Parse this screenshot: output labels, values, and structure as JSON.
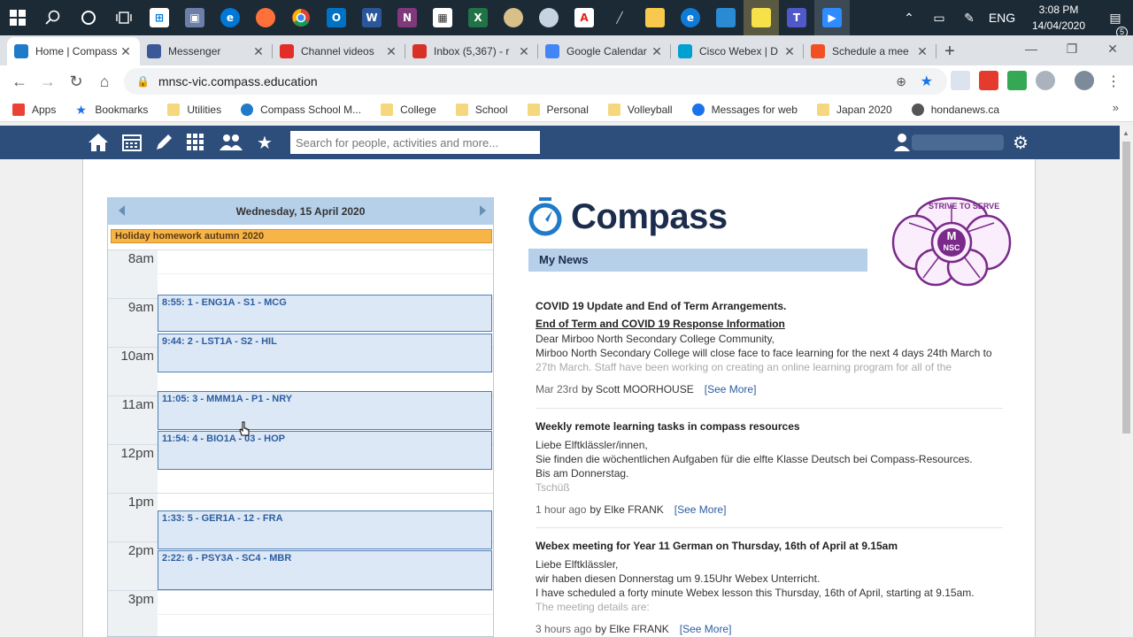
{
  "taskbar": {
    "apps": [
      "Windows",
      "Search",
      "Cortana",
      "Task View",
      "Store",
      "Save",
      "Edge",
      "Firefox",
      "Chrome",
      "Outlook",
      "Word",
      "OneNote",
      "Calculator",
      "Excel",
      "Paint",
      "Network",
      "Acrobat",
      "Pen",
      "Explorer",
      "Edge",
      "Photos",
      "Sticky Notes",
      "Teams",
      "Zoom"
    ],
    "language": "ENG",
    "time": "3:08 PM",
    "date": "14/04/2020",
    "notifications": "5"
  },
  "tabs": [
    {
      "title": "Home | Compass",
      "favicon": "compass-icon",
      "color": "#1f7ac9",
      "active": true
    },
    {
      "title": "Messenger",
      "favicon": "facebook-icon",
      "color": "#3b5998"
    },
    {
      "title": "Channel videos",
      "favicon": "youtube-icon",
      "color": "#e52d27"
    },
    {
      "title": "Inbox (5,367) - r",
      "favicon": "gmail-icon",
      "color": "#d93025"
    },
    {
      "title": "Google Calendar",
      "favicon": "calendar-icon",
      "color": "#4285f4"
    },
    {
      "title": "Cisco Webex | D",
      "favicon": "webex-icon",
      "color": "#00a0d1"
    },
    {
      "title": "Schedule a mee",
      "favicon": "microsoft-icon",
      "color": "#f25022"
    }
  ],
  "address": {
    "url": "mnsc-vic.compass.education"
  },
  "bookmarks": [
    {
      "label": "Apps",
      "icon": "apps-grid-icon"
    },
    {
      "label": "Bookmarks",
      "icon": "star-icon"
    },
    {
      "label": "Utilities",
      "icon": "folder-icon"
    },
    {
      "label": "Compass School M...",
      "icon": "compass-icon"
    },
    {
      "label": "College",
      "icon": "folder-icon"
    },
    {
      "label": "School",
      "icon": "folder-icon"
    },
    {
      "label": "Personal",
      "icon": "folder-icon"
    },
    {
      "label": "Volleyball",
      "icon": "folder-icon"
    },
    {
      "label": "Messages for web",
      "icon": "messages-icon"
    },
    {
      "label": "Japan 2020",
      "icon": "folder-icon"
    },
    {
      "label": "hondanews.ca",
      "icon": "globe-icon"
    }
  ],
  "compass_nav": {
    "search_placeholder": "Search for people, activities and more..."
  },
  "calendar": {
    "date": "Wednesday, 15 April 2020",
    "all_day": "Holiday homework autumn 2020",
    "hours": [
      "8am",
      "9am",
      "10am",
      "11am",
      "12pm",
      "1pm",
      "2pm",
      "3pm"
    ],
    "events": [
      {
        "label": "8:55: 1 - ENG1A - S1 - MCG",
        "start": 8.92,
        "end": 9.7
      },
      {
        "label": "9:44: 2 - LST1A - S2 - HIL",
        "start": 9.73,
        "end": 10.53
      },
      {
        "label": "11:05: 3 - MMM1A - P1 - NRY",
        "start": 10.9,
        "end": 11.7
      },
      {
        "label": "11:54: 4 - BIO1A - 03 - HOP",
        "start": 11.72,
        "end": 12.53
      },
      {
        "label": "1:33: 5 - GER1A - 12 - FRA",
        "start": 13.37,
        "end": 14.17
      },
      {
        "label": "2:22: 6 - PSY3A - SC4 - MBR",
        "start": 14.19,
        "end": 15.0
      }
    ]
  },
  "news": {
    "logo_text": "Compass",
    "heading": "My News",
    "items": [
      {
        "title": "COVID 19 Update and End of Term Arrangements.",
        "subtitle": "End of Term and COVID 19 Response Information",
        "lines": [
          "Dear Mirboo North Secondary College Community,",
          "Mirboo North Secondary College will close face to face learning for the next 4 days 24th March to",
          "27th March.  Staff have been working on creating an online learning program for all of the"
        ],
        "date": "Mar 23rd",
        "by": "by Scott MOORHOUSE",
        "see_more": "[See More]"
      },
      {
        "title": "Weekly remote learning tasks in compass resources",
        "subtitle": "",
        "lines": [
          "Liebe Elftklässler/innen,",
          "Sie finden die wöchentlichen Aufgaben für die elfte Klasse Deutsch bei Compass-Resources.",
          "Bis am Donnerstag.",
          "Tschüß"
        ],
        "date": "1 hour ago",
        "by": "by Elke FRANK",
        "see_more": "[See More]"
      },
      {
        "title": "Webex meeting for Year 11 German on Thursday, 16th of April at 9.15am",
        "subtitle": "",
        "lines": [
          "Liebe Elftklässler,",
          "wir haben diesen Donnerstag um 9.15Uhr Webex Unterricht.",
          "I have scheduled a forty minute Webex lesson this Thursday, 16th of April, starting at 9.15am.",
          "The meeting details are:"
        ],
        "date": "3 hours ago",
        "by": "by Elke FRANK",
        "see_more": "[See More]"
      }
    ]
  },
  "school_logo": {
    "motto": "STRIVE TO SERVE",
    "initials_top": "M",
    "initials_bottom": "NSC",
    "color": "#7a2a8a"
  }
}
